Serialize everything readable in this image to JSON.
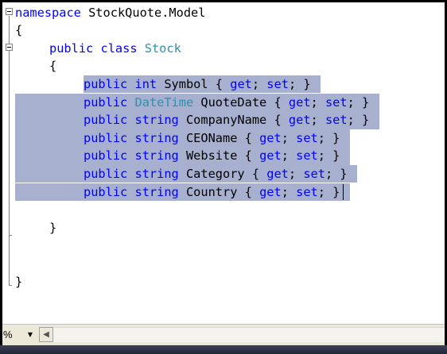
{
  "editor": {
    "lines": [
      {
        "indent": 0,
        "tokens": [
          {
            "t": "namespace",
            "c": "kw"
          },
          {
            "t": " StockQuote.Model",
            "c": "pl"
          }
        ]
      },
      {
        "indent": 0,
        "tokens": [
          {
            "t": "{",
            "c": "pl"
          }
        ]
      },
      {
        "indent": 1,
        "tokens": [
          {
            "t": "public",
            "c": "kw"
          },
          {
            "t": " ",
            "c": "pl"
          },
          {
            "t": "class",
            "c": "kw"
          },
          {
            "t": " ",
            "c": "pl"
          },
          {
            "t": "Stock",
            "c": "ty"
          }
        ]
      },
      {
        "indent": 1,
        "tokens": [
          {
            "t": "{",
            "c": "pl"
          }
        ]
      },
      {
        "indent": 2,
        "selected": true,
        "tokens": [
          {
            "t": "public",
            "c": "kw"
          },
          {
            "t": " ",
            "c": "pl"
          },
          {
            "t": "int",
            "c": "kw"
          },
          {
            "t": " Symbol { ",
            "c": "pl"
          },
          {
            "t": "get",
            "c": "kw"
          },
          {
            "t": "; ",
            "c": "pl"
          },
          {
            "t": "set",
            "c": "kw"
          },
          {
            "t": "; }",
            "c": "pl"
          }
        ]
      },
      {
        "indent": 2,
        "selected": true,
        "tokens": [
          {
            "t": "public",
            "c": "kw"
          },
          {
            "t": " ",
            "c": "pl"
          },
          {
            "t": "DateTime",
            "c": "ty"
          },
          {
            "t": " QuoteDate { ",
            "c": "pl"
          },
          {
            "t": "get",
            "c": "kw"
          },
          {
            "t": "; ",
            "c": "pl"
          },
          {
            "t": "set",
            "c": "kw"
          },
          {
            "t": "; }",
            "c": "pl"
          }
        ]
      },
      {
        "indent": 2,
        "selected": true,
        "tokens": [
          {
            "t": "public",
            "c": "kw"
          },
          {
            "t": " ",
            "c": "pl"
          },
          {
            "t": "string",
            "c": "kw"
          },
          {
            "t": " CompanyName { ",
            "c": "pl"
          },
          {
            "t": "get",
            "c": "kw"
          },
          {
            "t": "; ",
            "c": "pl"
          },
          {
            "t": "set",
            "c": "kw"
          },
          {
            "t": "; }",
            "c": "pl"
          }
        ]
      },
      {
        "indent": 2,
        "selected": true,
        "tokens": [
          {
            "t": "public",
            "c": "kw"
          },
          {
            "t": " ",
            "c": "pl"
          },
          {
            "t": "string",
            "c": "kw"
          },
          {
            "t": " CEOName { ",
            "c": "pl"
          },
          {
            "t": "get",
            "c": "kw"
          },
          {
            "t": "; ",
            "c": "pl"
          },
          {
            "t": "set",
            "c": "kw"
          },
          {
            "t": "; }",
            "c": "pl"
          }
        ]
      },
      {
        "indent": 2,
        "selected": true,
        "tokens": [
          {
            "t": "public",
            "c": "kw"
          },
          {
            "t": " ",
            "c": "pl"
          },
          {
            "t": "string",
            "c": "kw"
          },
          {
            "t": " Website { ",
            "c": "pl"
          },
          {
            "t": "get",
            "c": "kw"
          },
          {
            "t": "; ",
            "c": "pl"
          },
          {
            "t": "set",
            "c": "kw"
          },
          {
            "t": "; }",
            "c": "pl"
          }
        ]
      },
      {
        "indent": 2,
        "selected": true,
        "tokens": [
          {
            "t": "public",
            "c": "kw"
          },
          {
            "t": " ",
            "c": "pl"
          },
          {
            "t": "string",
            "c": "kw"
          },
          {
            "t": " Category { ",
            "c": "pl"
          },
          {
            "t": "get",
            "c": "kw"
          },
          {
            "t": "; ",
            "c": "pl"
          },
          {
            "t": "set",
            "c": "kw"
          },
          {
            "t": "; }",
            "c": "pl"
          }
        ]
      },
      {
        "indent": 2,
        "selected": true,
        "caret": true,
        "tokens": [
          {
            "t": "public",
            "c": "kw"
          },
          {
            "t": " ",
            "c": "pl"
          },
          {
            "t": "string",
            "c": "kw"
          },
          {
            "t": " Country { ",
            "c": "pl"
          },
          {
            "t": "get",
            "c": "kw"
          },
          {
            "t": "; ",
            "c": "pl"
          },
          {
            "t": "set",
            "c": "kw"
          },
          {
            "t": "; }",
            "c": "pl"
          }
        ]
      },
      {
        "indent": 0,
        "tokens": []
      },
      {
        "indent": 1,
        "tokens": [
          {
            "t": "}",
            "c": "pl"
          }
        ]
      },
      {
        "indent": 0,
        "tokens": []
      },
      {
        "indent": 0,
        "tokens": []
      },
      {
        "indent": 0,
        "tokens": [
          {
            "t": "}",
            "c": "pl"
          }
        ]
      }
    ]
  },
  "statusbar": {
    "zoom_label": "%",
    "zoom_dropdown_icon": "▼",
    "scroll_left_icon": "◀"
  },
  "colors": {
    "keyword": "#0000ff",
    "type": "#2b91af",
    "selection": "#a7b0cf"
  }
}
